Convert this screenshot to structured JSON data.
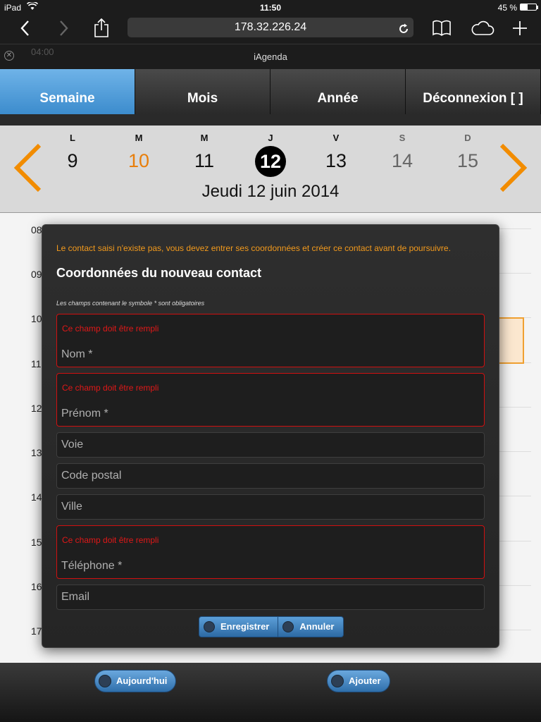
{
  "status_bar": {
    "device": "iPad",
    "time": "11:50",
    "battery": "45 %"
  },
  "browser": {
    "url": "178.32.226.24",
    "tab_title": "iAgenda",
    "ghost_time": "04:00"
  },
  "nav": {
    "items": [
      {
        "label": "Semaine",
        "active": true
      },
      {
        "label": "Mois"
      },
      {
        "label": "Année"
      },
      {
        "label": "Déconnexion [ ]"
      }
    ]
  },
  "week": {
    "days": [
      {
        "letter": "L",
        "num": "9"
      },
      {
        "letter": "M",
        "num": "10"
      },
      {
        "letter": "M",
        "num": "11"
      },
      {
        "letter": "J",
        "num": "12"
      },
      {
        "letter": "V",
        "num": "13"
      },
      {
        "letter": "S",
        "num": "14"
      },
      {
        "letter": "D",
        "num": "15"
      }
    ],
    "date_line": "Jeudi 12 juin 2014",
    "accent_color": "#e87e0a"
  },
  "grid": {
    "hours": [
      "08",
      "09",
      "10",
      "11",
      "12",
      "13",
      "14",
      "15",
      "16",
      "17"
    ]
  },
  "modal": {
    "warning": "Le contact saisi n'existe pas, vous devez entrer ses coordonnées et créer ce contact avant de poursuivre.",
    "title": "Coordonnées du nouveau contact",
    "note": "Les champs contenant le symbole * sont obligatoires",
    "required_error": "Ce champ doit être rempli",
    "fields": {
      "nom": "Nom *",
      "prenom": "Prénom *",
      "voie": "Voie",
      "code_postal": "Code postal",
      "ville": "Ville",
      "telephone": "Téléphone *",
      "email": "Email"
    },
    "save_label": "Enregistrer",
    "cancel_label": "Annuler"
  },
  "toolbar": {
    "today_label": "Aujourd'hui",
    "add_label": "Ajouter"
  }
}
